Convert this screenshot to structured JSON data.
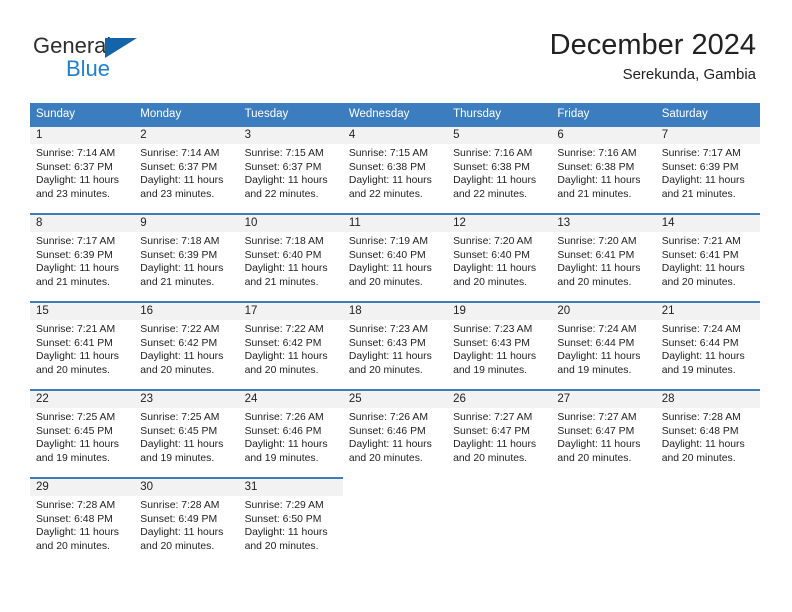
{
  "brand": {
    "name_top": "General",
    "name_bottom": "Blue",
    "accent_color": "#1f80d0",
    "triangle_color": "#1464aa",
    "triangle_icon": "triangle-icon"
  },
  "header": {
    "title": "December 2024",
    "subtitle": "Serekunda, Gambia"
  },
  "theme": {
    "header_bg": "#3b7dbf",
    "header_text": "#ffffff",
    "day_band_bg": "#f2f2f2",
    "body_text": "#222222"
  },
  "weekdays": [
    "Sunday",
    "Monday",
    "Tuesday",
    "Wednesday",
    "Thursday",
    "Friday",
    "Saturday"
  ],
  "weeks": [
    [
      {
        "day": "1",
        "sunrise": "Sunrise: 7:14 AM",
        "sunset": "Sunset: 6:37 PM",
        "daylight1": "Daylight: 11 hours",
        "daylight2": "and 23 minutes."
      },
      {
        "day": "2",
        "sunrise": "Sunrise: 7:14 AM",
        "sunset": "Sunset: 6:37 PM",
        "daylight1": "Daylight: 11 hours",
        "daylight2": "and 23 minutes."
      },
      {
        "day": "3",
        "sunrise": "Sunrise: 7:15 AM",
        "sunset": "Sunset: 6:37 PM",
        "daylight1": "Daylight: 11 hours",
        "daylight2": "and 22 minutes."
      },
      {
        "day": "4",
        "sunrise": "Sunrise: 7:15 AM",
        "sunset": "Sunset: 6:38 PM",
        "daylight1": "Daylight: 11 hours",
        "daylight2": "and 22 minutes."
      },
      {
        "day": "5",
        "sunrise": "Sunrise: 7:16 AM",
        "sunset": "Sunset: 6:38 PM",
        "daylight1": "Daylight: 11 hours",
        "daylight2": "and 22 minutes."
      },
      {
        "day": "6",
        "sunrise": "Sunrise: 7:16 AM",
        "sunset": "Sunset: 6:38 PM",
        "daylight1": "Daylight: 11 hours",
        "daylight2": "and 21 minutes."
      },
      {
        "day": "7",
        "sunrise": "Sunrise: 7:17 AM",
        "sunset": "Sunset: 6:39 PM",
        "daylight1": "Daylight: 11 hours",
        "daylight2": "and 21 minutes."
      }
    ],
    [
      {
        "day": "8",
        "sunrise": "Sunrise: 7:17 AM",
        "sunset": "Sunset: 6:39 PM",
        "daylight1": "Daylight: 11 hours",
        "daylight2": "and 21 minutes."
      },
      {
        "day": "9",
        "sunrise": "Sunrise: 7:18 AM",
        "sunset": "Sunset: 6:39 PM",
        "daylight1": "Daylight: 11 hours",
        "daylight2": "and 21 minutes."
      },
      {
        "day": "10",
        "sunrise": "Sunrise: 7:18 AM",
        "sunset": "Sunset: 6:40 PM",
        "daylight1": "Daylight: 11 hours",
        "daylight2": "and 21 minutes."
      },
      {
        "day": "11",
        "sunrise": "Sunrise: 7:19 AM",
        "sunset": "Sunset: 6:40 PM",
        "daylight1": "Daylight: 11 hours",
        "daylight2": "and 20 minutes."
      },
      {
        "day": "12",
        "sunrise": "Sunrise: 7:20 AM",
        "sunset": "Sunset: 6:40 PM",
        "daylight1": "Daylight: 11 hours",
        "daylight2": "and 20 minutes."
      },
      {
        "day": "13",
        "sunrise": "Sunrise: 7:20 AM",
        "sunset": "Sunset: 6:41 PM",
        "daylight1": "Daylight: 11 hours",
        "daylight2": "and 20 minutes."
      },
      {
        "day": "14",
        "sunrise": "Sunrise: 7:21 AM",
        "sunset": "Sunset: 6:41 PM",
        "daylight1": "Daylight: 11 hours",
        "daylight2": "and 20 minutes."
      }
    ],
    [
      {
        "day": "15",
        "sunrise": "Sunrise: 7:21 AM",
        "sunset": "Sunset: 6:41 PM",
        "daylight1": "Daylight: 11 hours",
        "daylight2": "and 20 minutes."
      },
      {
        "day": "16",
        "sunrise": "Sunrise: 7:22 AM",
        "sunset": "Sunset: 6:42 PM",
        "daylight1": "Daylight: 11 hours",
        "daylight2": "and 20 minutes."
      },
      {
        "day": "17",
        "sunrise": "Sunrise: 7:22 AM",
        "sunset": "Sunset: 6:42 PM",
        "daylight1": "Daylight: 11 hours",
        "daylight2": "and 20 minutes."
      },
      {
        "day": "18",
        "sunrise": "Sunrise: 7:23 AM",
        "sunset": "Sunset: 6:43 PM",
        "daylight1": "Daylight: 11 hours",
        "daylight2": "and 20 minutes."
      },
      {
        "day": "19",
        "sunrise": "Sunrise: 7:23 AM",
        "sunset": "Sunset: 6:43 PM",
        "daylight1": "Daylight: 11 hours",
        "daylight2": "and 19 minutes."
      },
      {
        "day": "20",
        "sunrise": "Sunrise: 7:24 AM",
        "sunset": "Sunset: 6:44 PM",
        "daylight1": "Daylight: 11 hours",
        "daylight2": "and 19 minutes."
      },
      {
        "day": "21",
        "sunrise": "Sunrise: 7:24 AM",
        "sunset": "Sunset: 6:44 PM",
        "daylight1": "Daylight: 11 hours",
        "daylight2": "and 19 minutes."
      }
    ],
    [
      {
        "day": "22",
        "sunrise": "Sunrise: 7:25 AM",
        "sunset": "Sunset: 6:45 PM",
        "daylight1": "Daylight: 11 hours",
        "daylight2": "and 19 minutes."
      },
      {
        "day": "23",
        "sunrise": "Sunrise: 7:25 AM",
        "sunset": "Sunset: 6:45 PM",
        "daylight1": "Daylight: 11 hours",
        "daylight2": "and 19 minutes."
      },
      {
        "day": "24",
        "sunrise": "Sunrise: 7:26 AM",
        "sunset": "Sunset: 6:46 PM",
        "daylight1": "Daylight: 11 hours",
        "daylight2": "and 19 minutes."
      },
      {
        "day": "25",
        "sunrise": "Sunrise: 7:26 AM",
        "sunset": "Sunset: 6:46 PM",
        "daylight1": "Daylight: 11 hours",
        "daylight2": "and 20 minutes."
      },
      {
        "day": "26",
        "sunrise": "Sunrise: 7:27 AM",
        "sunset": "Sunset: 6:47 PM",
        "daylight1": "Daylight: 11 hours",
        "daylight2": "and 20 minutes."
      },
      {
        "day": "27",
        "sunrise": "Sunrise: 7:27 AM",
        "sunset": "Sunset: 6:47 PM",
        "daylight1": "Daylight: 11 hours",
        "daylight2": "and 20 minutes."
      },
      {
        "day": "28",
        "sunrise": "Sunrise: 7:28 AM",
        "sunset": "Sunset: 6:48 PM",
        "daylight1": "Daylight: 11 hours",
        "daylight2": "and 20 minutes."
      }
    ],
    [
      {
        "day": "29",
        "sunrise": "Sunrise: 7:28 AM",
        "sunset": "Sunset: 6:48 PM",
        "daylight1": "Daylight: 11 hours",
        "daylight2": "and 20 minutes."
      },
      {
        "day": "30",
        "sunrise": "Sunrise: 7:28 AM",
        "sunset": "Sunset: 6:49 PM",
        "daylight1": "Daylight: 11 hours",
        "daylight2": "and 20 minutes."
      },
      {
        "day": "31",
        "sunrise": "Sunrise: 7:29 AM",
        "sunset": "Sunset: 6:50 PM",
        "daylight1": "Daylight: 11 hours",
        "daylight2": "and 20 minutes."
      },
      {
        "day": "",
        "sunrise": "",
        "sunset": "",
        "daylight1": "",
        "daylight2": ""
      },
      {
        "day": "",
        "sunrise": "",
        "sunset": "",
        "daylight1": "",
        "daylight2": ""
      },
      {
        "day": "",
        "sunrise": "",
        "sunset": "",
        "daylight1": "",
        "daylight2": ""
      },
      {
        "day": "",
        "sunrise": "",
        "sunset": "",
        "daylight1": "",
        "daylight2": ""
      }
    ]
  ]
}
